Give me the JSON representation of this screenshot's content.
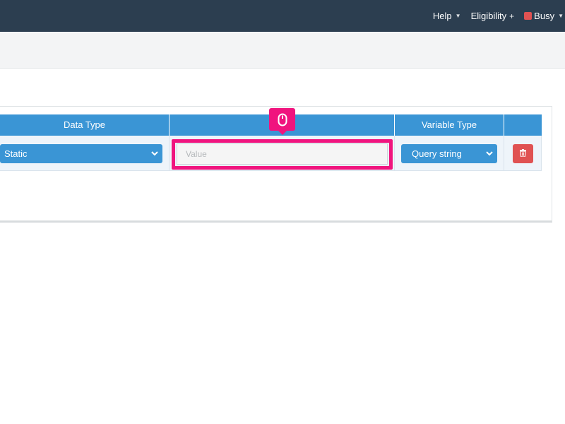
{
  "topbar": {
    "help_label": "Help",
    "eligibility_label": "Eligibility",
    "status_label": "Busy",
    "status_color": "#e05252"
  },
  "table": {
    "columns": [
      "Data Type",
      "",
      "Variable Type",
      ""
    ],
    "row": {
      "data_type": "Static",
      "value_placeholder": "Value",
      "value": "",
      "variable_type": "Query string"
    }
  },
  "colors": {
    "header_bg": "#2c3e50",
    "accent": "#3a95d5",
    "highlight": "#f0147e",
    "danger": "#e05252"
  },
  "icons": {
    "annotation": "mouse-icon",
    "delete": "trash-icon",
    "dropdown": "chevron-down-icon"
  }
}
